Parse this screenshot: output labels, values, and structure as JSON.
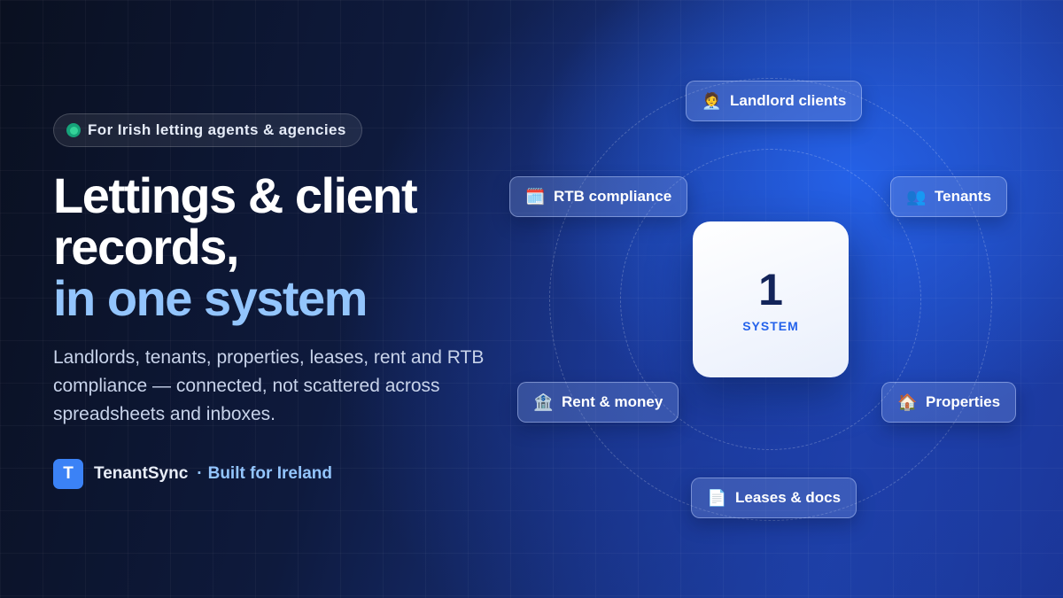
{
  "badge": {
    "text": "For Irish letting agents & agencies"
  },
  "headline": {
    "line1": "Lettings & client records,",
    "accent": "in one system"
  },
  "subtitle": "Landlords, tenants, properties, leases, rent and RTB compliance — connected, not scattered across spreadsheets and inboxes.",
  "brand": {
    "logo_letter": "T",
    "name": "TenantSync",
    "separator": "·",
    "tagline": "Built for Ireland"
  },
  "hub": {
    "number": "1",
    "label": "SYSTEM"
  },
  "nodes": {
    "landlord": {
      "icon": "🧑‍💼",
      "label": "Landlord clients"
    },
    "rtb": {
      "icon": "🗓️",
      "label": "RTB compliance"
    },
    "tenants": {
      "icon": "👥",
      "label": "Tenants"
    },
    "rent": {
      "icon": "🏦",
      "label": "Rent & money"
    },
    "properties": {
      "icon": "🏠",
      "label": "Properties"
    },
    "leases": {
      "icon": "📄",
      "label": "Leases & docs"
    }
  },
  "colors": {
    "accent": "#93c5fd",
    "logo": "#3b82f6",
    "hub_label": "#2563eb",
    "status_dot": "#34d399"
  }
}
